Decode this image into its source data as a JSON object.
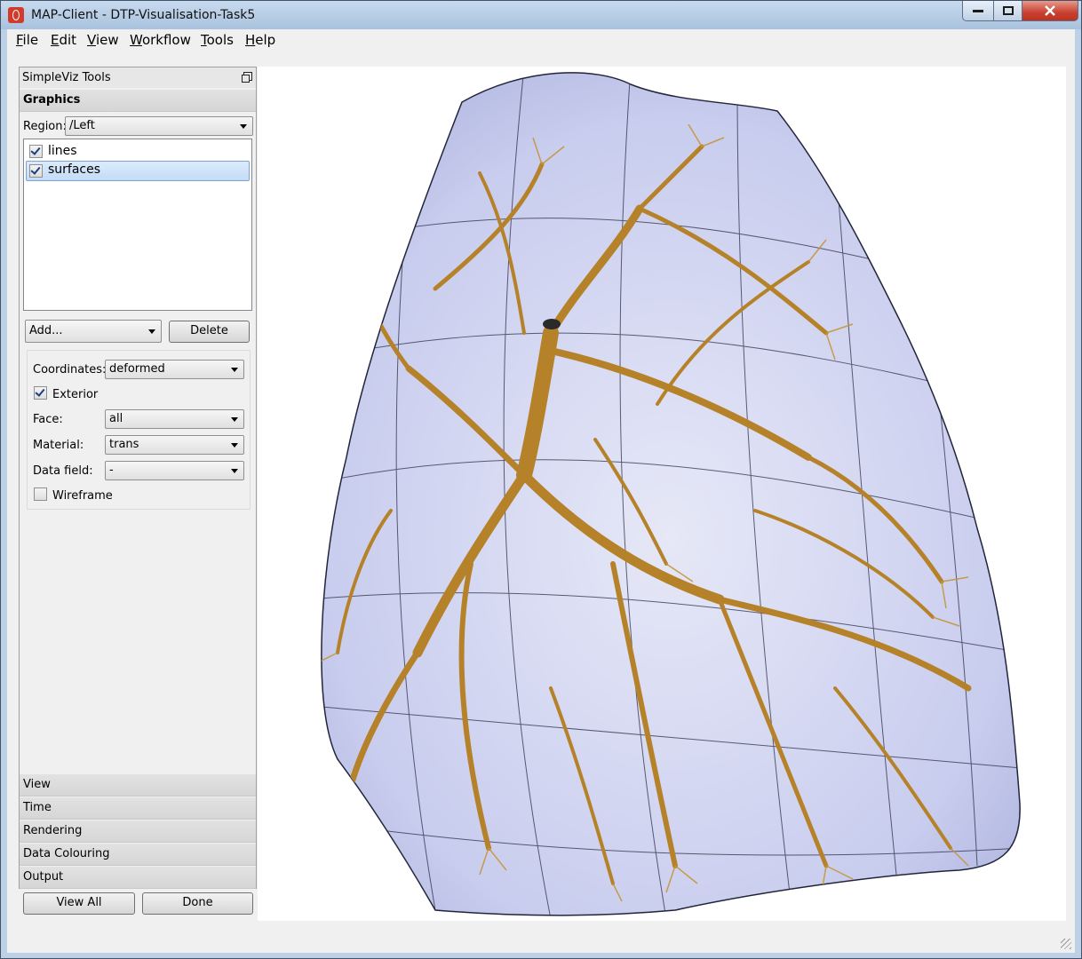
{
  "window": {
    "title": "MAP-Client - DTP-Visualisation-Task5"
  },
  "menu": [
    {
      "label": "File",
      "key": "F",
      "rest": "ile"
    },
    {
      "label": "Edit",
      "key": "E",
      "rest": "dit"
    },
    {
      "label": "View",
      "key": "V",
      "rest": "iew"
    },
    {
      "label": "Workflow",
      "key": "W",
      "rest": "orkflow"
    },
    {
      "label": "Tools",
      "key": "T",
      "rest": "ools"
    },
    {
      "label": "Help",
      "key": "H",
      "rest": "elp"
    }
  ],
  "panel": {
    "title": "SimpleViz Tools",
    "graphics_header": "Graphics",
    "region_label": "Region:",
    "region_value": "/Left",
    "graphics_list": [
      {
        "label": "lines",
        "checked": true
      },
      {
        "label": "surfaces",
        "checked": true,
        "selected": true
      }
    ],
    "add_combo": "Add...",
    "delete_button": "Delete",
    "coordinates_label": "Coordinates:",
    "coordinates_value": "deformed",
    "exterior_label": "Exterior",
    "exterior_checked": true,
    "face_label": "Face:",
    "face_value": "all",
    "material_label": "Material:",
    "material_value": "trans",
    "data_field_label": "Data field:",
    "data_field_value": "-",
    "wireframe_label": "Wireframe",
    "wireframe_checked": false,
    "sections": [
      "View",
      "Time",
      "Rendering",
      "Data Colouring",
      "Output"
    ],
    "view_all_button": "View All",
    "done_button": "Done"
  },
  "scene": {
    "description_color_surface": "#b8bde8",
    "tree_color": "#c8962a",
    "background": "#ffffff"
  }
}
